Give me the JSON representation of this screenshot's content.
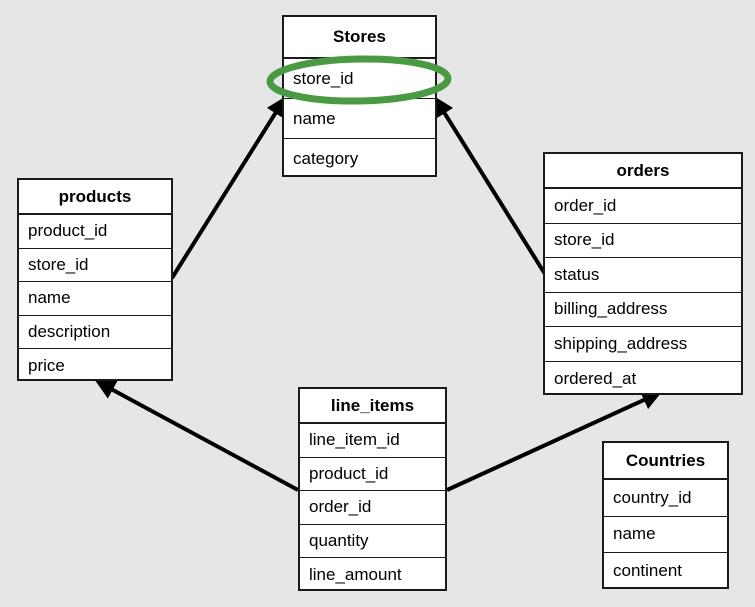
{
  "diagram": {
    "type": "entity-relationship-diagram",
    "background_color": "#e6e6e6",
    "entity_border_color": "#1a1a1a",
    "entity_fill_color": "#ffffff",
    "connector_color": "#000000",
    "highlight_color": "#4a9a44"
  },
  "entities": [
    {
      "id": "stores",
      "title": "Stores",
      "fields": [
        "store_id",
        "name",
        "category"
      ]
    },
    {
      "id": "products",
      "title": "products",
      "fields": [
        "product_id",
        "store_id",
        "name",
        "description",
        "price"
      ]
    },
    {
      "id": "orders",
      "title": "orders",
      "fields": [
        "order_id",
        "store_id",
        "status",
        "billing_address",
        "shipping_address",
        "ordered_at"
      ]
    },
    {
      "id": "line_items",
      "title": "line_items",
      "fields": [
        "line_item_id",
        "product_id",
        "order_id",
        "quantity",
        "line_amount"
      ]
    },
    {
      "id": "countries",
      "title": "Countries",
      "fields": [
        "country_id",
        "name",
        "continent"
      ]
    }
  ],
  "highlight": {
    "target_entity": "Stores",
    "target_field": "store_id",
    "shape": "ellipse",
    "color": "#4a9a44"
  },
  "relationships": [
    {
      "from": "products",
      "to": "Stores",
      "from_field": "store_id",
      "to_field": "store_id"
    },
    {
      "from": "orders",
      "to": "Stores",
      "from_field": "store_id",
      "to_field": "store_id"
    },
    {
      "from": "line_items",
      "to": "products",
      "from_field": "product_id",
      "to_field": "product_id"
    },
    {
      "from": "line_items",
      "to": "orders",
      "from_field": "order_id",
      "to_field": "order_id"
    }
  ]
}
